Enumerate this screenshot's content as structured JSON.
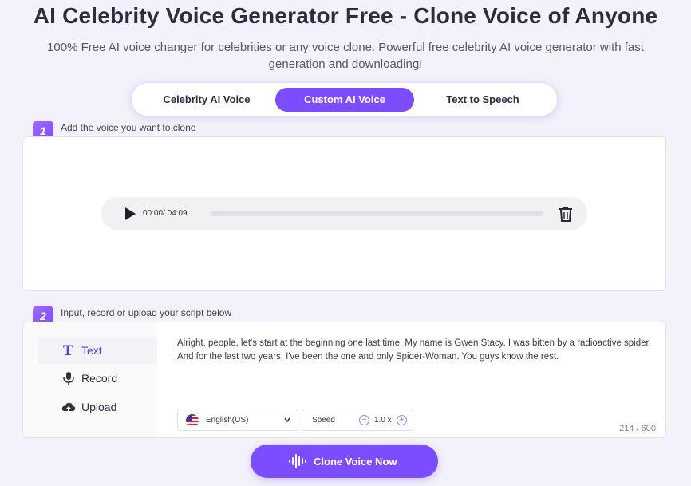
{
  "header": {
    "title": "AI Celebrity Voice Generator Free - Clone Voice of Anyone",
    "subtitle": "100% Free AI voice changer for celebrities or any voice clone. Powerful free celebrity AI voice generator with fast generation and downloading!"
  },
  "tabs": [
    {
      "label": "Celebrity AI Voice",
      "active": false
    },
    {
      "label": "Custom AI Voice",
      "active": true
    },
    {
      "label": "Text to Speech",
      "active": false
    }
  ],
  "step1": {
    "number": "1",
    "label": "Add the voice you want to clone",
    "player": {
      "time": "00:00/ 04:09",
      "progress": 0.0
    }
  },
  "step2": {
    "number": "2",
    "label": "Input, record or upload your script below",
    "modes": [
      {
        "label": "Text",
        "icon": "text-icon",
        "active": true
      },
      {
        "label": "Record",
        "icon": "microphone-icon",
        "active": false
      },
      {
        "label": "Upload",
        "icon": "cloud-upload-icon",
        "active": false
      }
    ],
    "script": "Alright, people, let's start at the beginning one last time. My name is Gwen Stacy. I was bitten by a radioactive spider. And for the last two years, I've been the one and only Spider-Woman. You guys know the rest.",
    "language": "English(US)",
    "speed_label": "Speed",
    "speed_value": "1.0 x",
    "counter": "214 / 600"
  },
  "cta": {
    "label": "Clone Voice Now"
  },
  "colors": {
    "accent": "#7c4dff",
    "background": "#f3f2fa"
  }
}
